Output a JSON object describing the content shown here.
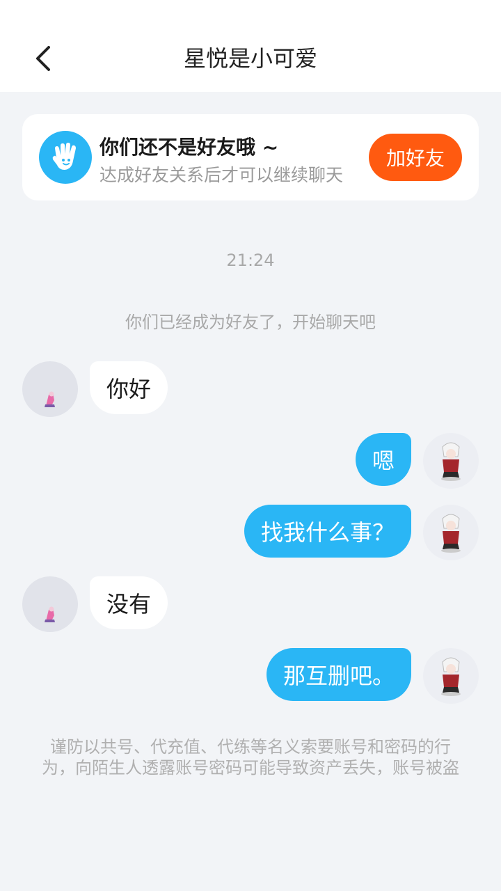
{
  "header": {
    "title": "星悦是小可爱",
    "back_icon": "chevron-left-icon"
  },
  "friend_card": {
    "icon": "hand-wave-icon",
    "title": "你们还不是好友哦 ~",
    "subtitle": "达成好友关系后才可以继续聊天",
    "add_button_label": "加好友"
  },
  "chat": {
    "time": "21:24",
    "system_message": "你们已经成为好友了，开始聊天吧",
    "messages": [
      {
        "side": "left",
        "text": "你好"
      },
      {
        "side": "right",
        "text": "嗯"
      },
      {
        "side": "right",
        "text": "找我什么事？"
      },
      {
        "side": "left",
        "text": "没有"
      },
      {
        "side": "right",
        "text": "那互删吧。"
      }
    ]
  },
  "warning": "谨防以共号、代充值、代练等名义索要账号和密码的行为，向陌生人透露账号密码可能导致资产丢失，账号被盗",
  "colors": {
    "accent_blue": "#2ab6f5",
    "add_button_orange": "#ff5a10",
    "background": "#f2f4f7"
  }
}
